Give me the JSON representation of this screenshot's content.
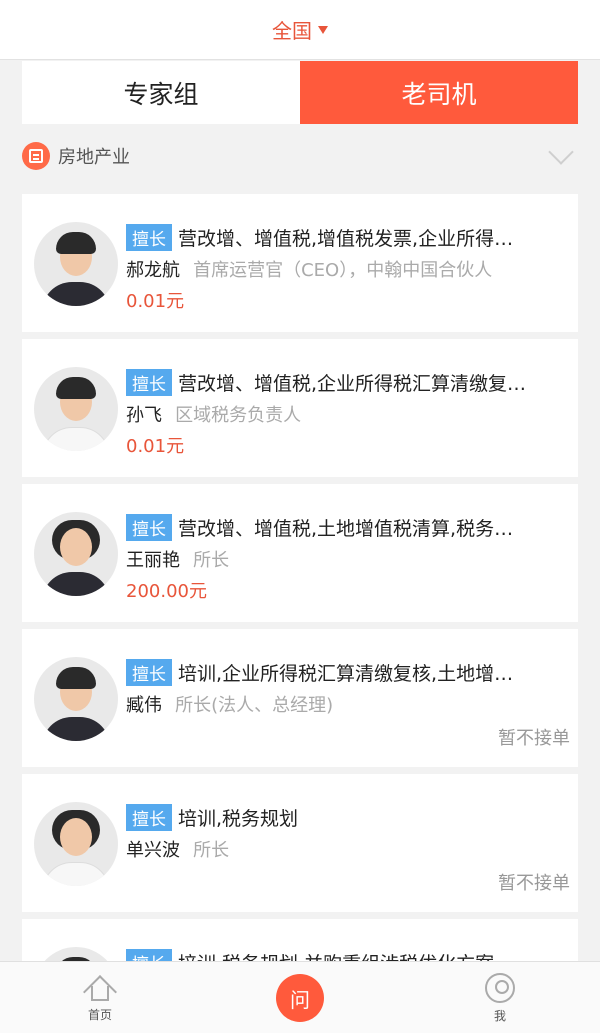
{
  "header": {
    "region": "全国"
  },
  "tabs": [
    {
      "label": "专家组",
      "active": false
    },
    {
      "label": "老司机",
      "active": true
    }
  ],
  "filter": {
    "industry": "房地产业"
  },
  "experts": [
    {
      "badge": "擅长",
      "skills": "营改增、增值税,增值税发票,企业所得…",
      "name": "郝龙航",
      "title": "首席运营官（CEO），中翰中国合伙人",
      "price": "0.01元",
      "status": ""
    },
    {
      "badge": "擅长",
      "skills": "营改增、增值税,企业所得税汇算清缴复…",
      "name": "孙飞",
      "title": "区域税务负责人",
      "price": "0.01元",
      "status": ""
    },
    {
      "badge": "擅长",
      "skills": "营改增、增值税,土地增值税清算,税务…",
      "name": "王丽艳",
      "title": "所长",
      "price": "200.00元",
      "status": ""
    },
    {
      "badge": "擅长",
      "skills": "培训,企业所得税汇算清缴复核,土地增…",
      "name": "臧伟",
      "title": "所长(法人、总经理)",
      "price": "",
      "status": "暂不接单"
    },
    {
      "badge": "擅长",
      "skills": "培训,税务规划",
      "name": "单兴波",
      "title": "所长",
      "price": "",
      "status": "暂不接单"
    },
    {
      "badge": "擅长",
      "skills": "培训,税务规划,并购重组涉税优化方案",
      "name": "",
      "title": "",
      "price": "",
      "status": ""
    }
  ],
  "tabbar": {
    "home": "首页",
    "ask": "问",
    "me": "我"
  }
}
